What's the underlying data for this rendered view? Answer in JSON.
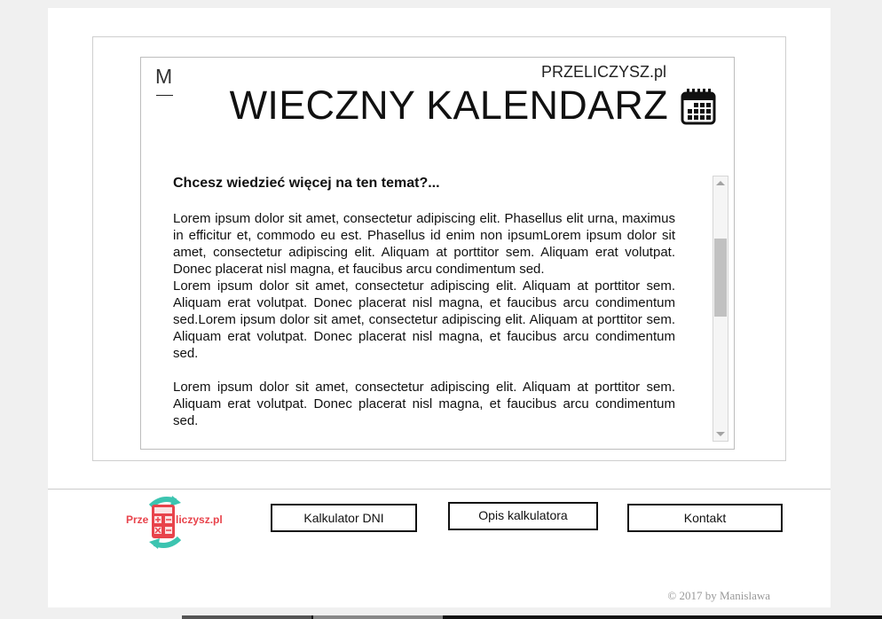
{
  "header": {
    "menu_glyph": "M",
    "brand": "PRZELICZYSZ.pl",
    "title": "WIECZNY KALENDARZ"
  },
  "article": {
    "heading": "Chcesz wiedzieć więcej na ten temat?...",
    "paragraphs": [
      "Lorem ipsum dolor sit amet, consectetur adipiscing elit. Phasellus elit urna, maximus in efficitur et, commodo eu est. Phasellus id enim non ipsumLorem ipsum dolor sit amet, consectetur adipiscing elit. Aliquam at porttitor sem.  Aliquam erat volutpat. Donec placerat nisl magna, et faucibus arcu condimentum sed.",
      "Lorem ipsum dolor sit amet, consectetur adipiscing elit. Aliquam at porttitor sem.  Aliquam erat volutpat. Donec placerat nisl magna, et faucibus arcu condimentum sed.Lorem ipsum dolor sit amet, consectetur adipiscing elit. Aliquam at porttitor sem.  Aliquam erat volutpat. Donec placerat nisl magna, et faucibus arcu condimentum sed.",
      "Lorem ipsum dolor sit amet, consectetur adipiscing elit. Aliquam at porttitor sem.  Aliquam erat volutpat. Donec placerat nisl magna, et faucibus arcu condimentum sed."
    ]
  },
  "footer": {
    "logo_text_left": "Prze",
    "logo_text_right": "liczysz.pl",
    "nav": [
      "Kalkulator DNI",
      "Opis kalkulatora",
      "Kontakt"
    ],
    "copyright": "© 2017 by Manislawa"
  },
  "colors": {
    "logo_red": "#e8434b",
    "logo_teal": "#3cc4b0"
  },
  "icons": {
    "calendar": "calendar-icon"
  }
}
